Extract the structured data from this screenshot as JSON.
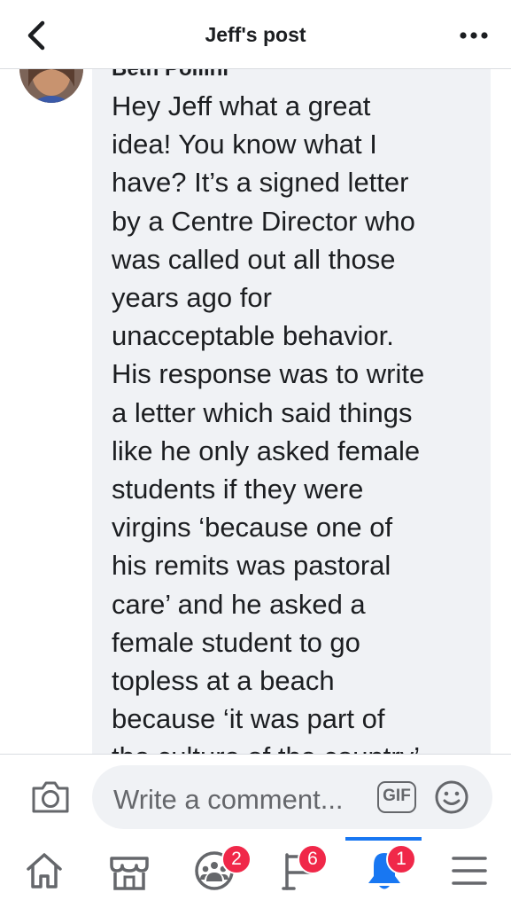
{
  "header": {
    "title": "Jeff's post"
  },
  "comment": {
    "author": "Beth Pollini",
    "text": "Hey Jeff what a great\nidea! You know what I\nhave? It’s a signed letter\nby a Centre Director who\nwas called out all those\nyears ago for\nunacceptable behavior.\nHis response was to write\na letter which said things\nlike he only asked female\nstudents if they were\nvirgins ‘because one of\nhis remits was pastoral\ncare’ and he asked a\nfemale student to go\ntopless at a beach\nbecause ‘it was part of\nthe culture of the country’"
  },
  "composer": {
    "placeholder": "Write a comment...",
    "gif_label": "GIF"
  },
  "nav": {
    "items": [
      {
        "icon": "home-icon",
        "badge": ""
      },
      {
        "icon": "marketplace-icon",
        "badge": ""
      },
      {
        "icon": "groups-icon",
        "badge": "2"
      },
      {
        "icon": "pages-flag-icon",
        "badge": "6"
      },
      {
        "icon": "notifications-bell-icon",
        "badge": "1",
        "active": true
      },
      {
        "icon": "menu-icon",
        "badge": ""
      }
    ]
  },
  "colors": {
    "accent": "#1877f2",
    "badge": "#f02849",
    "bubble": "#f0f2f5",
    "muted": "#65676b"
  }
}
